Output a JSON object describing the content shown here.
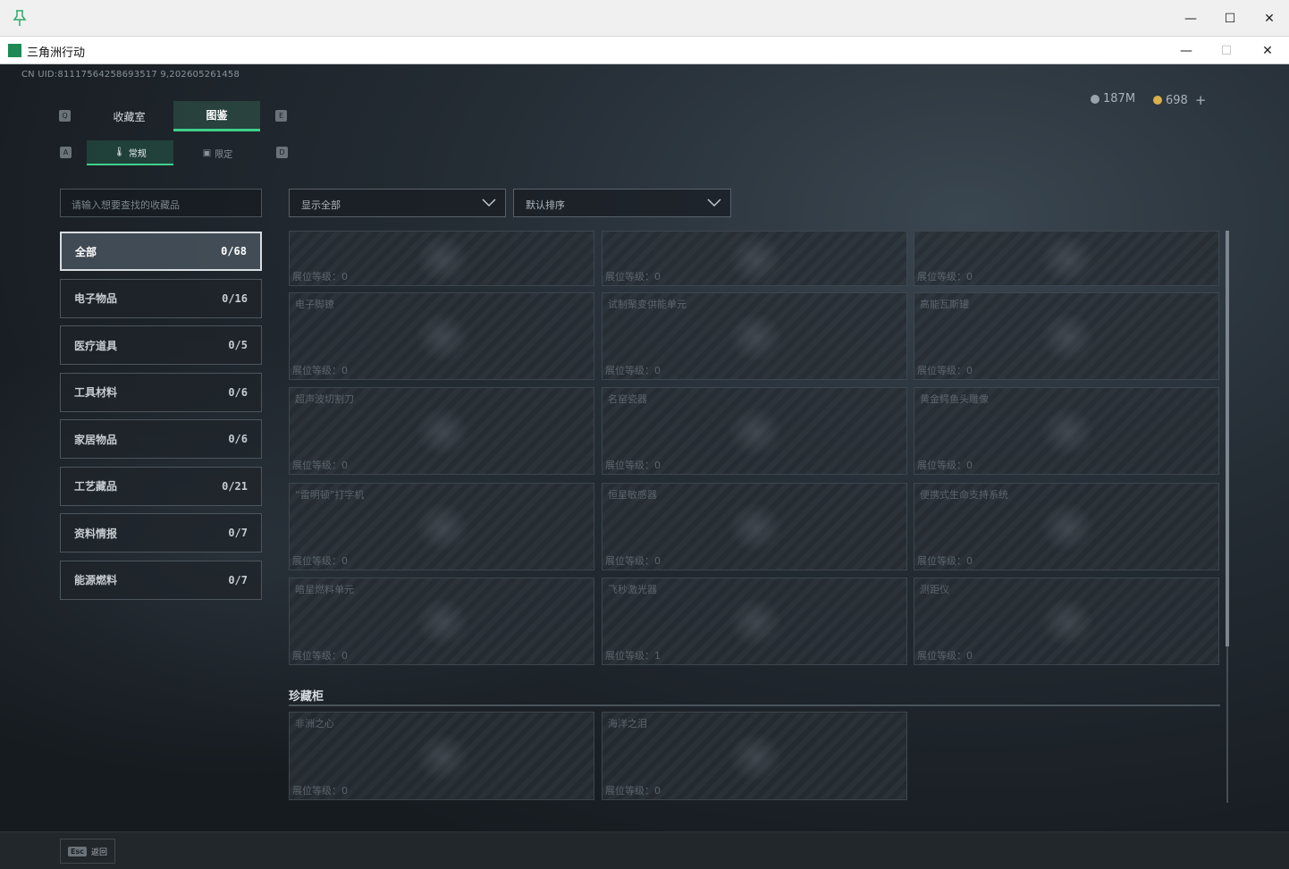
{
  "outer_window": {
    "controls": {
      "minimize": "—",
      "maximize": "☐",
      "close": "✕"
    }
  },
  "window": {
    "title": "三角洲行动",
    "controls": {
      "minimize": "—",
      "maximize": "☐",
      "close": "✕"
    }
  },
  "header": {
    "uid": "CN UID:81117564258693517 9,202605261458",
    "currency": [
      {
        "value": "187M"
      },
      {
        "value": "698"
      }
    ],
    "add_label": "+"
  },
  "hotkeys": {
    "tab_prev": "Q",
    "tab_next": "E",
    "subtab_prev": "A",
    "subtab_next": "D"
  },
  "tabs": [
    {
      "label": "收藏室"
    },
    {
      "label": "图鉴"
    }
  ],
  "subtabs": [
    {
      "label": "常规"
    },
    {
      "label": "限定"
    }
  ],
  "search": {
    "placeholder": "请输入想要查找的收藏品"
  },
  "categories": [
    {
      "label": "全部",
      "count": "0/68"
    },
    {
      "label": "电子物品",
      "count": "0/16"
    },
    {
      "label": "医疗道具",
      "count": "0/5"
    },
    {
      "label": "工具材料",
      "count": "0/6"
    },
    {
      "label": "家居物品",
      "count": "0/6"
    },
    {
      "label": "工艺藏品",
      "count": "0/21"
    },
    {
      "label": "资料情报",
      "count": "0/7"
    },
    {
      "label": "能源燃料",
      "count": "0/7"
    }
  ],
  "filters": {
    "show": "显示全部",
    "sort": "默认排序"
  },
  "cards": [
    {
      "name": "",
      "level": "展位等级：0"
    },
    {
      "name": "",
      "level": "展位等级：0"
    },
    {
      "name": "",
      "level": "展位等级：0"
    },
    {
      "name": "电子脚镣",
      "level": "展位等级：0"
    },
    {
      "name": "试制聚变供能单元",
      "level": "展位等级：0"
    },
    {
      "name": "高能瓦斯罐",
      "level": "展位等级：0"
    },
    {
      "name": "超声波切割刀",
      "level": "展位等级：0"
    },
    {
      "name": "名窑瓷器",
      "level": "展位等级：0"
    },
    {
      "name": "黄金鳄鱼头雕像",
      "level": "展位等级：0"
    },
    {
      "name": "“雷明顿”打字机",
      "level": "展位等级：0"
    },
    {
      "name": "恒星敏感器",
      "level": "展位等级：0"
    },
    {
      "name": "便携式生命支持系统",
      "level": "展位等级：0"
    },
    {
      "name": "暗星燃料单元",
      "level": "展位等级：0"
    },
    {
      "name": "飞秒激光器",
      "level": "展位等级：1"
    },
    {
      "name": "测距仪",
      "level": "展位等级：0"
    }
  ],
  "treasure": {
    "title": "珍藏柜",
    "cards": [
      {
        "name": "非洲之心",
        "level": "展位等级：0"
      },
      {
        "name": "海洋之泪",
        "level": "展位等级：0"
      }
    ]
  },
  "footer": {
    "esc_key": "Esc",
    "back_label": "返回"
  }
}
